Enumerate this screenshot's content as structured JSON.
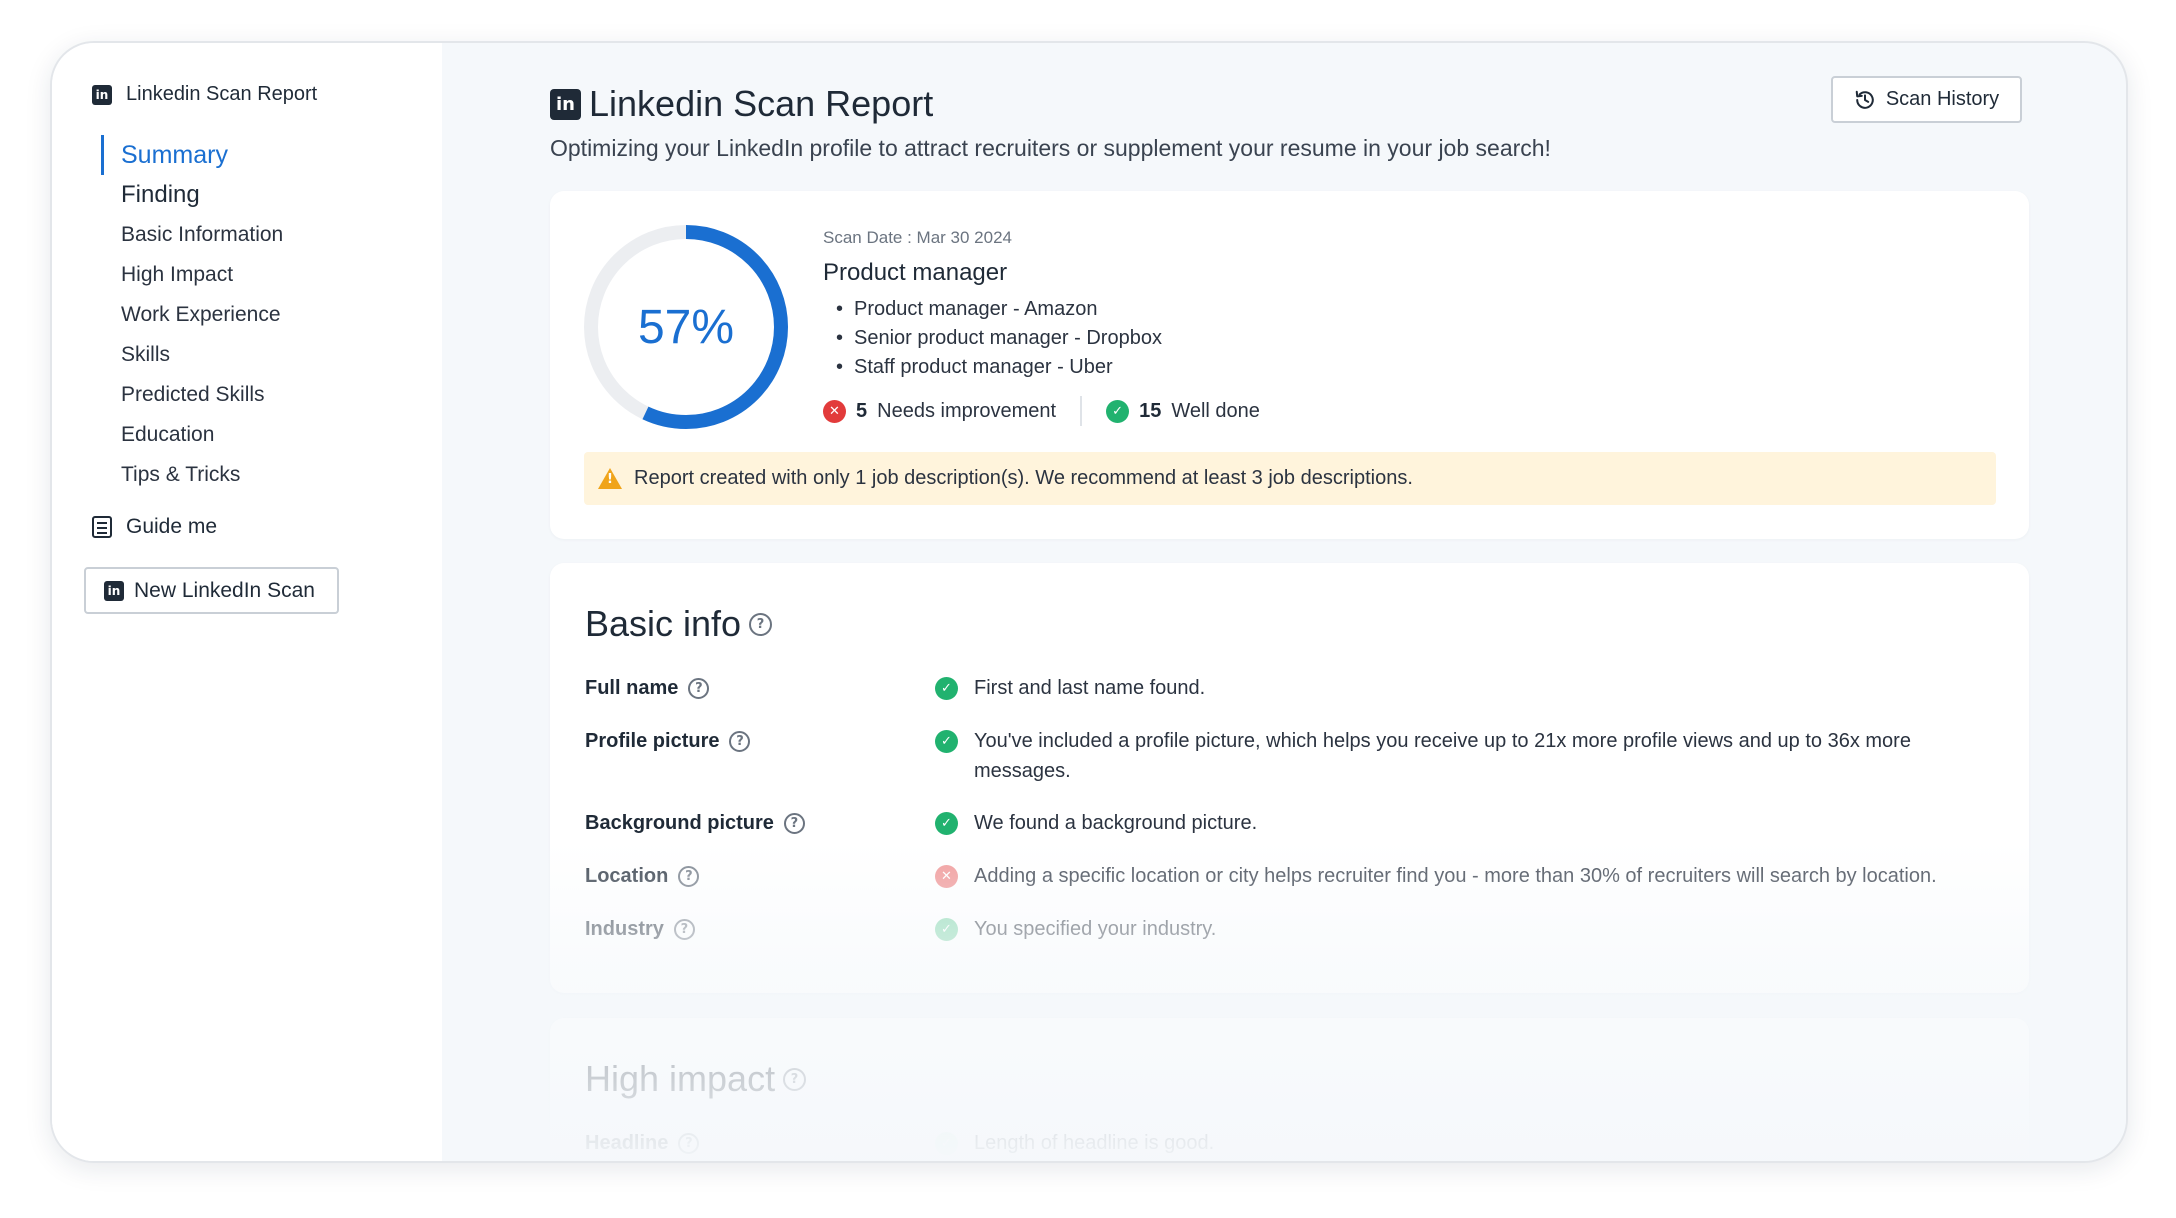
{
  "sidebar": {
    "header": "Linkedin Scan Report",
    "items": [
      {
        "label": "Summary"
      },
      {
        "label": "Finding"
      },
      {
        "label": "Basic Information"
      },
      {
        "label": "High Impact"
      },
      {
        "label": "Work Experience"
      },
      {
        "label": "Skills"
      },
      {
        "label": "Predicted Skills"
      },
      {
        "label": "Education"
      },
      {
        "label": "Tips & Tricks"
      }
    ],
    "guide_label": "Guide me",
    "new_scan_label": "New LinkedIn Scan"
  },
  "header": {
    "logo_text": "in",
    "title": "Linkedin Scan Report",
    "subtitle": "Optimizing your LinkedIn profile to attract recruiters or supplement your resume in your job search!",
    "history_label": "Scan History"
  },
  "summary": {
    "score": 57,
    "score_label": "57%",
    "scan_date": "Scan Date : Mar 30 2024",
    "role": "Product manager",
    "jobs": [
      "Product manager - Amazon",
      "Senior product manager - Dropbox",
      "Staff product manager - Uber"
    ],
    "needs_count": "5",
    "needs_label": "Needs improvement",
    "done_count": "15",
    "done_label": "Well done",
    "warning": "Report created with only 1 job description(s). We recommend at least 3 job descriptions.",
    "colors": {
      "accent": "#1a6fd1",
      "track": "#eceef1",
      "ok": "#21b26f",
      "bad": "#e23b3b",
      "warn_bg": "#fff4dc",
      "warn": "#f0a41a"
    }
  },
  "basic": {
    "title": "Basic info",
    "rows": [
      {
        "label": "Full name",
        "status": "ok",
        "message": "First and last name found."
      },
      {
        "label": "Profile picture",
        "status": "ok",
        "message": "You've included a profile picture, which helps you receive up to 21x more profile views and up to 36x more messages."
      },
      {
        "label": "Background picture",
        "status": "ok",
        "message": "We found a background picture."
      },
      {
        "label": "Location",
        "status": "bad",
        "message": "Adding a specific location or city helps recruiter find you - more than 30% of recruiters will search by location."
      },
      {
        "label": "Industry",
        "status": "ok",
        "message": "You specified your industry."
      }
    ]
  },
  "high": {
    "title": "High impact",
    "rows": [
      {
        "label": "Headline",
        "status": "ok",
        "message": "Length of headline is good."
      }
    ]
  },
  "icons": {
    "linkedin": "linkedin-icon",
    "history": "history-icon",
    "guide": "checklist-icon",
    "help": "help-circle-icon",
    "ok": "check-circle-icon",
    "bad": "x-circle-icon",
    "warning": "warning-icon"
  }
}
